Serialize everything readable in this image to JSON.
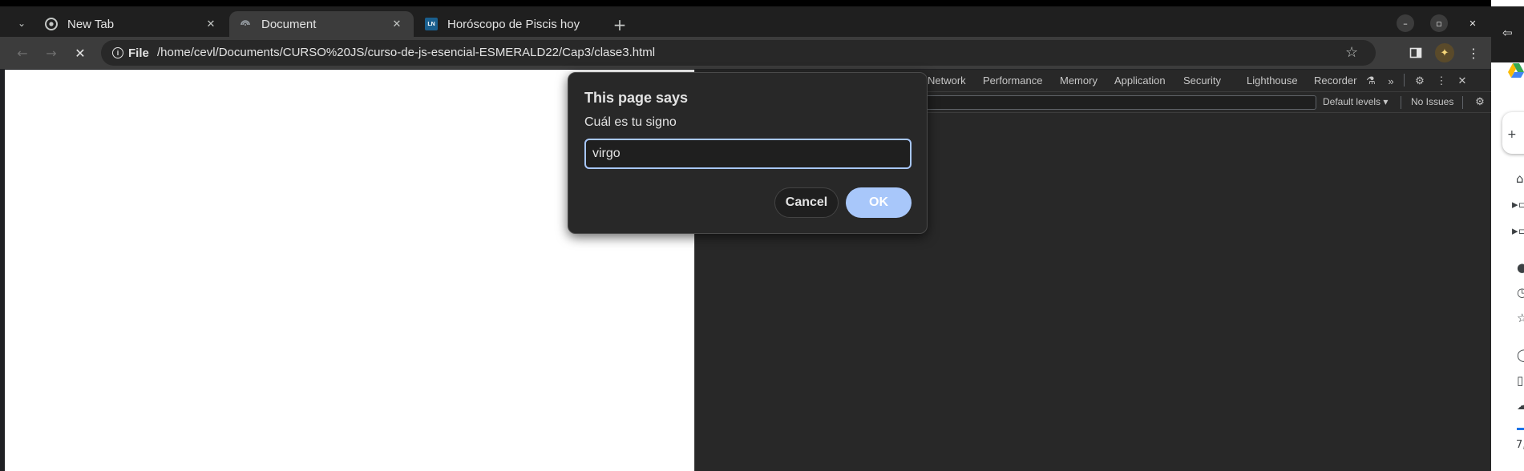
{
  "tabs": [
    {
      "label": "New Tab",
      "icon": "chrome-icon"
    },
    {
      "label": "Document",
      "icon": "loading-icon",
      "active": true
    },
    {
      "label": "Horóscopo de Piscis hoy",
      "icon": "ln-favicon",
      "favicon_text": "LN"
    }
  ],
  "toolbar": {
    "site_info_label": "File",
    "url": "/home/cevl/Documents/CURSO%20JS/curso-de-js-esencial-ESMERALD22/Cap3/clase3.html"
  },
  "devtools": {
    "tabs": [
      "Network",
      "Performance",
      "Memory",
      "Application",
      "Security",
      "Lighthouse",
      "Recorder"
    ],
    "levels_label": "Default levels ▾",
    "issues_label": "No Issues"
  },
  "dialog": {
    "title": "This page says",
    "message": "Cuál es tu signo",
    "input_value": "virgo",
    "cancel_label": "Cancel",
    "ok_label": "OK"
  },
  "side_panel": {
    "bottom_text": "7,"
  },
  "colors": {
    "accent": "#a8c7fa",
    "devtools_bg": "#282828",
    "toolbar_bg": "#3c3c3c",
    "tabstrip_bg": "#1f1f1f"
  }
}
